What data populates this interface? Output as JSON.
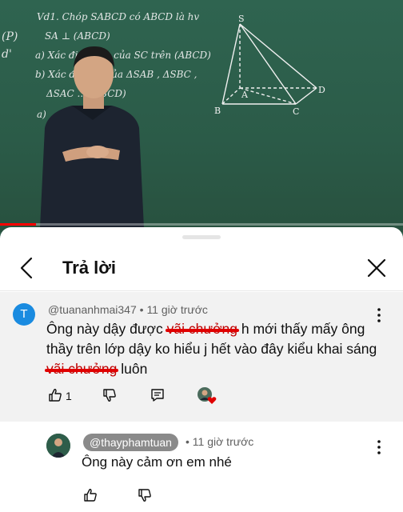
{
  "video": {
    "progress": 0.09,
    "board_lines": [
      "Vd1. Chóp SABCD có ABCD là hv",
      "SA ⊥ (ABCD)",
      "a) Xác định góc của SC trên (ABCD)",
      "b) Xác định ... của ΔSAB , ΔSBC ,",
      "ΔSAC ... (ABCD)",
      "a)"
    ],
    "side_marks": [
      "(P)",
      "d'"
    ],
    "pyramid_labels": [
      "S",
      "A",
      "B",
      "C",
      "D"
    ]
  },
  "sheet": {
    "title": "Trả lời"
  },
  "comment": {
    "avatar_letter": "T",
    "avatar_color": "#1a8be0",
    "author": "@tuananhmai347",
    "time": "11 giờ trước",
    "text_parts": [
      "Ông này dậy được ",
      "vãi chưởng",
      " h mới thấy mấy ông thầy trên lớp dậy ko hiểu j hết vào đây kiểu khai sáng ",
      "vãi chưởng",
      " luôn"
    ],
    "like_count": "1"
  },
  "reply": {
    "author": "@thayphamtuan",
    "author_pill_color": "#8a8a8a",
    "time": "11 giờ trước",
    "text": "Ông này cảm ơn em nhé"
  }
}
